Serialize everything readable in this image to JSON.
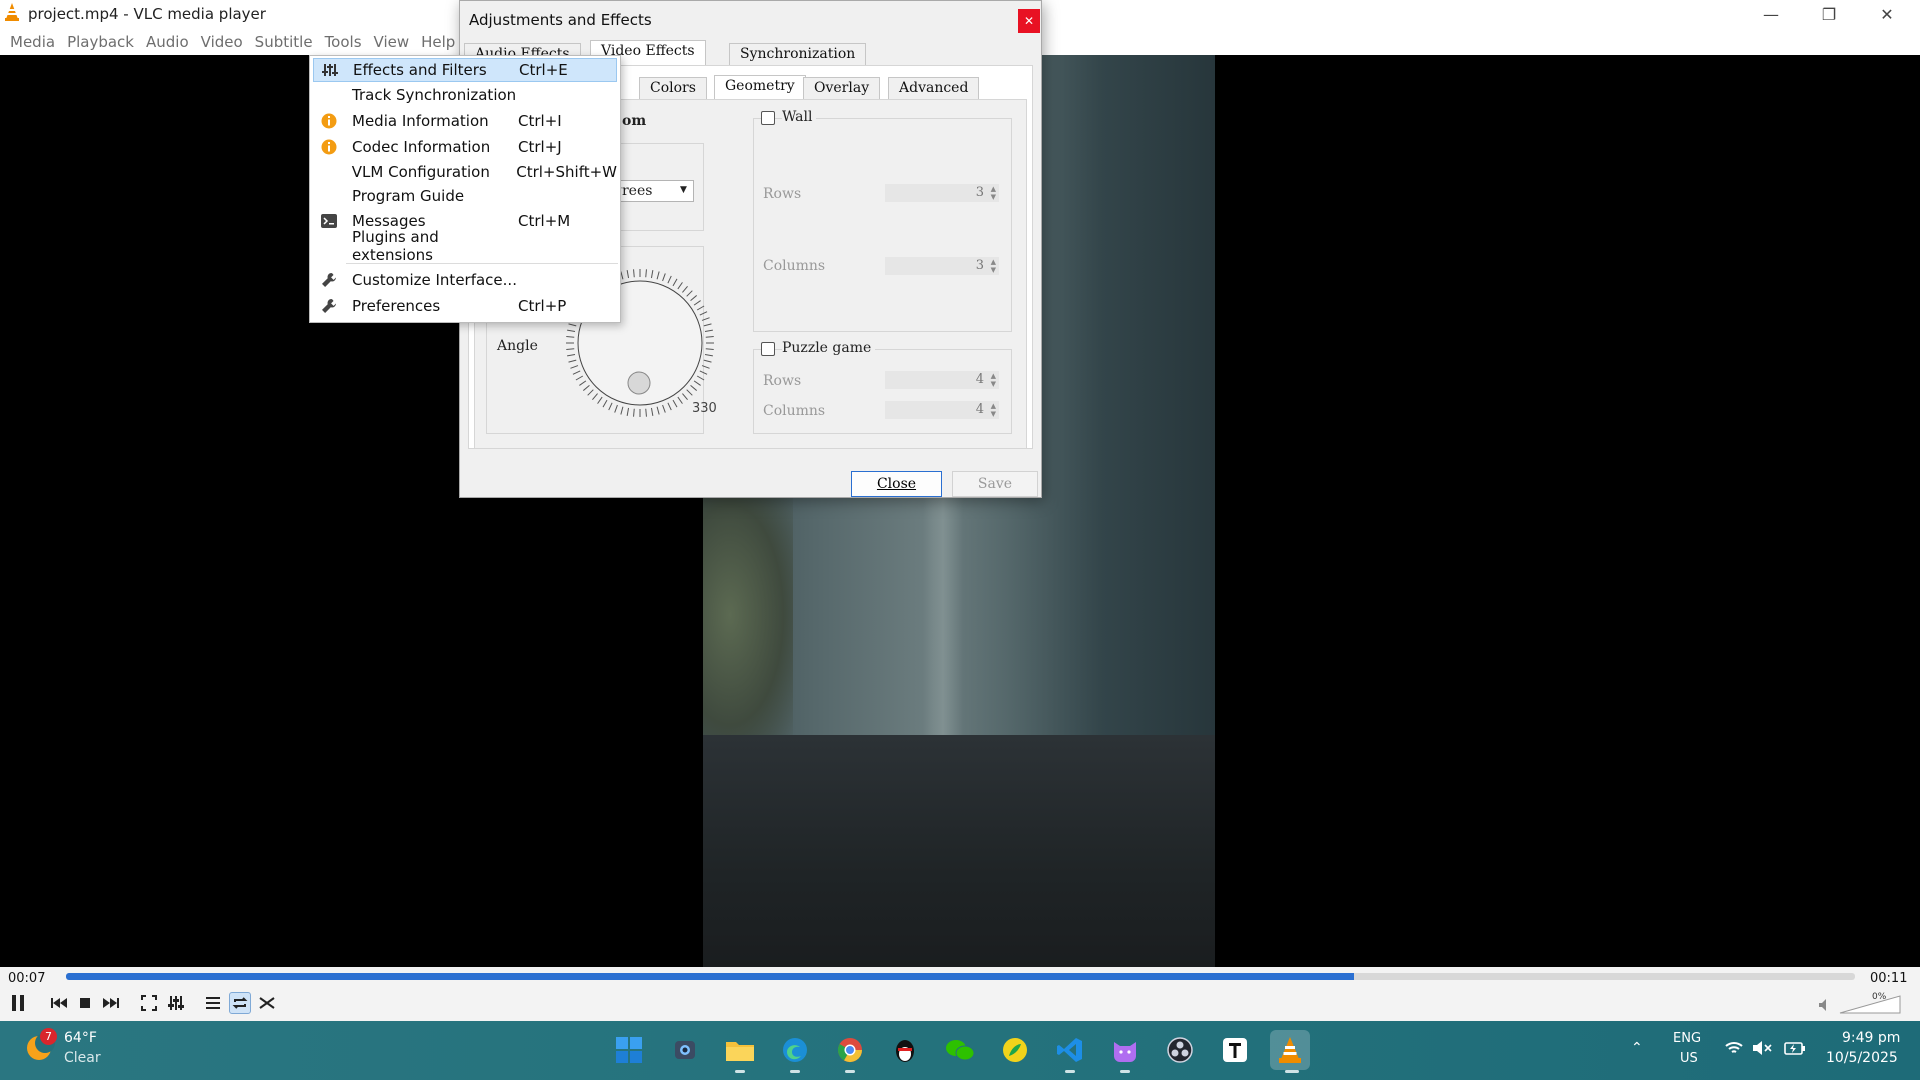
{
  "window": {
    "title": "project.mp4 - VLC media player"
  },
  "menubar": [
    "Media",
    "Playback",
    "Audio",
    "Video",
    "Subtitle",
    "Tools",
    "View",
    "Help"
  ],
  "tools_menu": {
    "items": [
      {
        "label": "Effects and Filters",
        "shortcut": "Ctrl+E",
        "icon": "equalizer-icon",
        "highlighted": true
      },
      {
        "label": "Track Synchronization",
        "shortcut": "",
        "icon": ""
      },
      {
        "label": "Media Information",
        "shortcut": "Ctrl+I",
        "icon": "info-icon"
      },
      {
        "label": "Codec Information",
        "shortcut": "Ctrl+J",
        "icon": "info-icon"
      },
      {
        "label": "VLM Configuration",
        "shortcut": "Ctrl+Shift+W",
        "icon": ""
      },
      {
        "label": "Program Guide",
        "shortcut": "",
        "icon": ""
      },
      {
        "label": "Messages",
        "shortcut": "Ctrl+M",
        "icon": "terminal-icon"
      },
      {
        "label": "Plugins and extensions",
        "shortcut": "",
        "icon": ""
      },
      {
        "label": "Customize Interface...",
        "shortcut": "",
        "icon": "wrench-icon"
      },
      {
        "label": "Preferences",
        "shortcut": "Ctrl+P",
        "icon": "wrench-icon"
      }
    ]
  },
  "dialog": {
    "title": "Adjustments and Effects",
    "tabs": [
      "Audio Effects",
      "Video Effects",
      "Synchronization"
    ],
    "subtabs": [
      "Colors",
      "Geometry",
      "Overlay",
      "Advanced"
    ],
    "partial_label": "om",
    "partial_dropdown": "grees",
    "angle": {
      "label": "Angle",
      "value": "330"
    },
    "wall": {
      "label": "Wall",
      "rows_label": "Rows",
      "rows": "3",
      "columns_label": "Columns",
      "columns": "3"
    },
    "puzzle": {
      "label": "Puzzle game",
      "rows_label": "Rows",
      "rows": "4",
      "columns_label": "Columns",
      "columns": "4"
    },
    "close_label": "Close",
    "save_label": "Save"
  },
  "player": {
    "elapsed": "00:07",
    "total": "00:11",
    "progress": 0.72,
    "volume": "0%"
  },
  "taskbar": {
    "weather_temp": "64°F",
    "weather_desc": "Clear",
    "weather_badge": "7",
    "lang": "ENG",
    "region": "US",
    "time": "9:49 pm",
    "date": "10/5/2025"
  },
  "colors": {
    "accent": "#2a6fd1",
    "menu_highlight": "#cfe6fb",
    "close_red": "#e81123",
    "vlc_orange": "#f08c00"
  }
}
